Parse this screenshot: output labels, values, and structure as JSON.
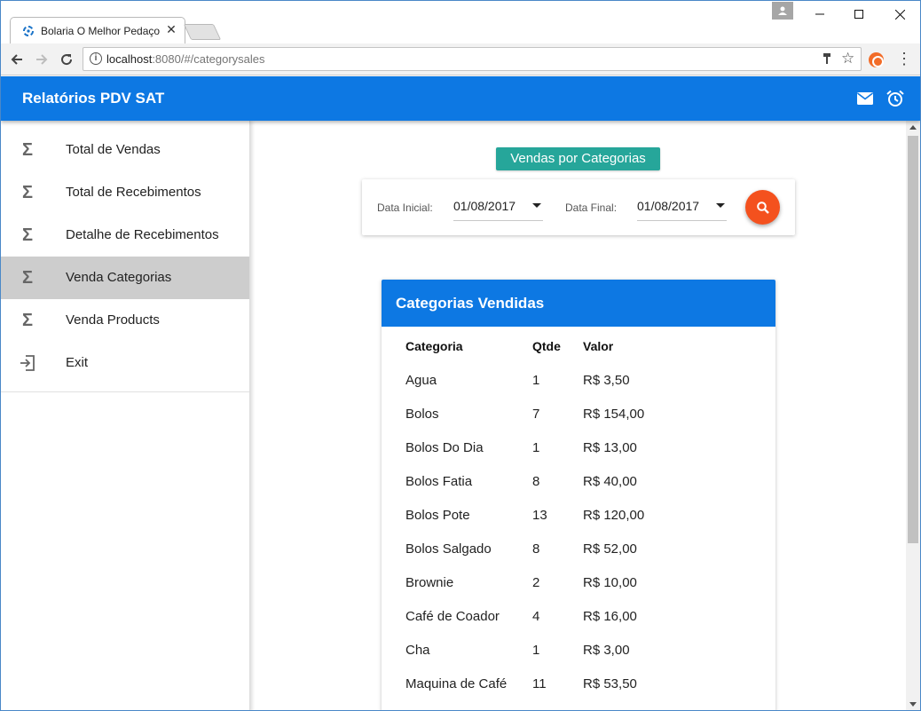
{
  "browser": {
    "tab_title": "Bolaria O Melhor Pedaço",
    "url_host": "localhost",
    "url_path": ":8080/#/categorysales"
  },
  "app": {
    "title": "Relatórios PDV SAT"
  },
  "sidebar": {
    "items": [
      {
        "label": "Total de Vendas",
        "icon": "sigma-icon"
      },
      {
        "label": "Total de Recebimentos",
        "icon": "sigma-icon"
      },
      {
        "label": "Detalhe de Recebimentos",
        "icon": "sigma-icon"
      },
      {
        "label": "Venda Categorias",
        "icon": "sigma-icon",
        "active": true
      },
      {
        "label": "Venda Products",
        "icon": "sigma-icon"
      },
      {
        "label": "Exit",
        "icon": "exit-icon"
      }
    ]
  },
  "main": {
    "page_title": "Vendas por Categorias",
    "filters": {
      "start_label": "Data Inicial:",
      "start_value": "01/08/2017",
      "end_label": "Data Final:",
      "end_value": "01/08/2017"
    },
    "table": {
      "title": "Categorias Vendidas",
      "headers": [
        "Categoria",
        "Qtde",
        "Valor"
      ],
      "rows": [
        [
          "Agua",
          "1",
          "R$ 3,50"
        ],
        [
          "Bolos",
          "7",
          "R$ 154,00"
        ],
        [
          "Bolos Do Dia",
          "1",
          "R$ 13,00"
        ],
        [
          "Bolos Fatia",
          "8",
          "R$ 40,00"
        ],
        [
          "Bolos Pote",
          "13",
          "R$ 120,00"
        ],
        [
          "Bolos Salgado",
          "8",
          "R$ 52,00"
        ],
        [
          "Brownie",
          "2",
          "R$ 10,00"
        ],
        [
          "Café de Coador",
          "4",
          "R$ 16,00"
        ],
        [
          "Cha",
          "1",
          "R$ 3,00"
        ],
        [
          "Maquina de Café",
          "11",
          "R$ 53,50"
        ]
      ]
    }
  },
  "colors": {
    "primary": "#0d78e3",
    "accent_teal": "#26a69a",
    "fab_orange": "#f4511e",
    "active_item": "#cdcdcd"
  }
}
